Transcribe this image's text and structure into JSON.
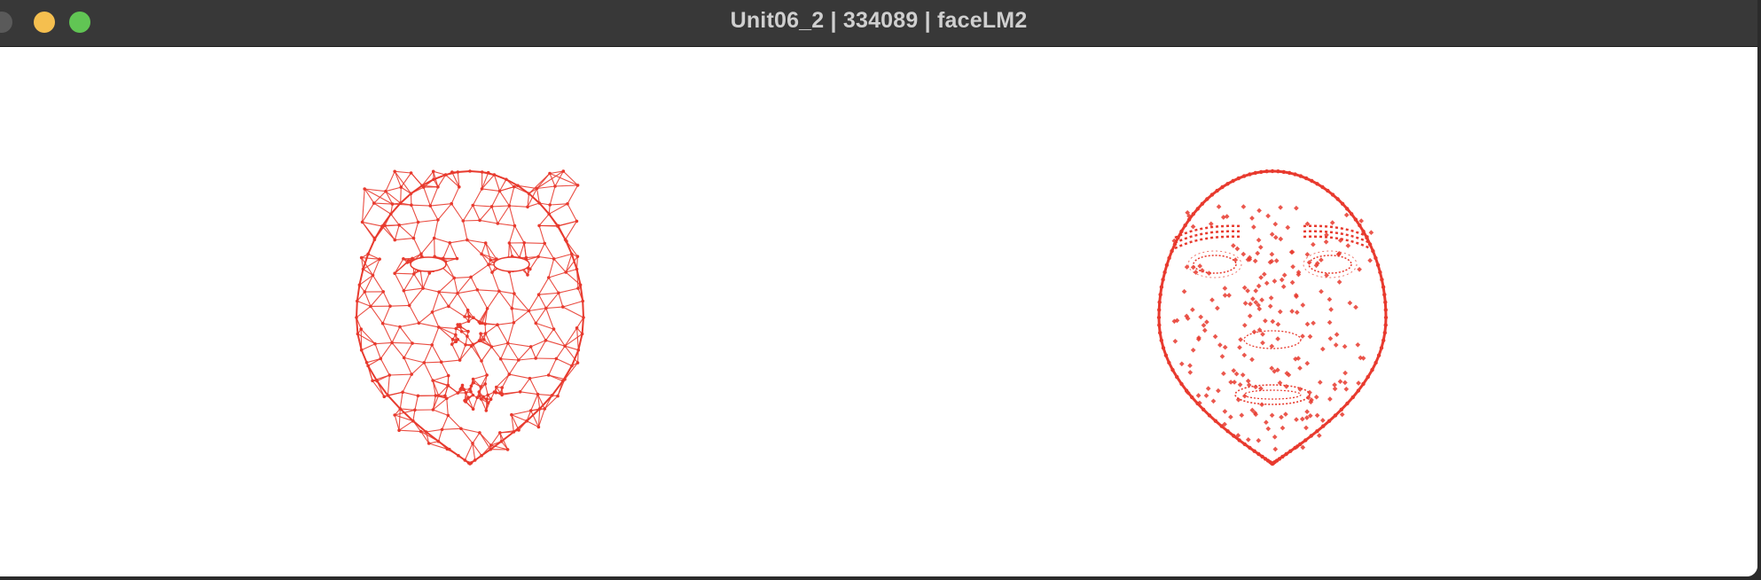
{
  "window": {
    "title": "Unit06_2 | 334089 | faceLM2",
    "controls": {
      "close_color": "#5a5a5a",
      "minimize_color": "#f5bf4f",
      "zoom_color": "#61c554"
    }
  },
  "canvas": {
    "background": "#ffffff",
    "landmark_color": "#e83a2e",
    "panels": [
      {
        "name": "face-mesh-wireframe",
        "style": "triangulated mesh with landmark points"
      },
      {
        "name": "face-landmark-points",
        "style": "landmark points only"
      }
    ]
  }
}
